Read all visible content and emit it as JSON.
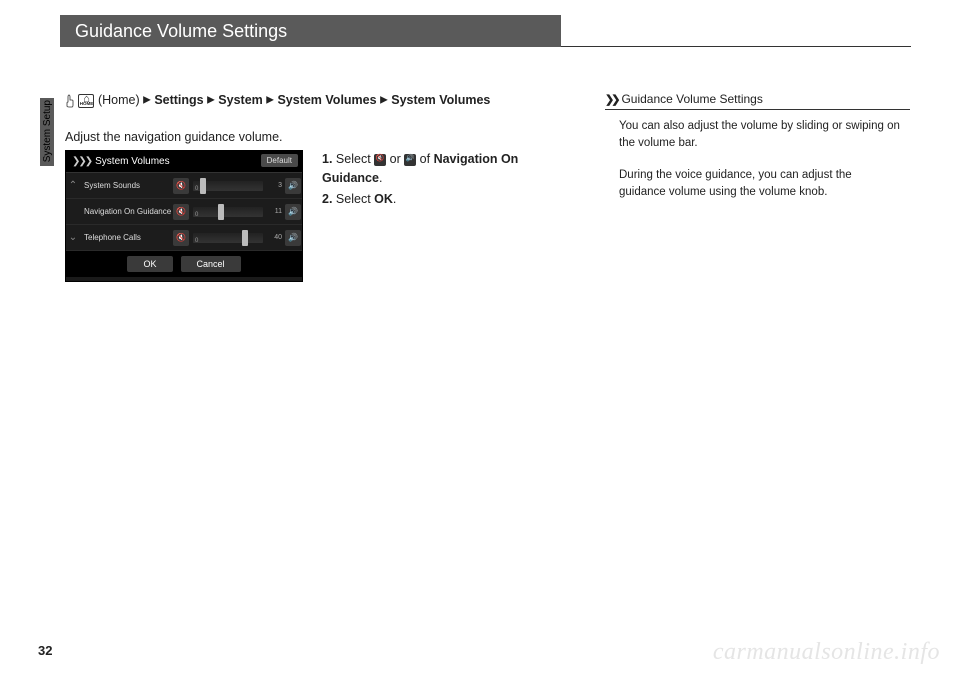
{
  "page": {
    "title": "Guidance Volume Settings",
    "number": "32",
    "side_label": "System Setup",
    "watermark": "carmanualsonline.info"
  },
  "breadcrumb": {
    "home_label": "(Home)",
    "settings": "Settings",
    "system": "System",
    "system_volumes_1": "System Volumes",
    "system_volumes_2": "System Volumes"
  },
  "intro_text": "Adjust the navigation guidance volume.",
  "screenshot": {
    "title": "System Volumes",
    "default": "Default",
    "rows": [
      {
        "label": "System Sounds",
        "value": "3",
        "handle_pct": 10
      },
      {
        "label": "Navigation On Guidance",
        "value": "11",
        "handle_pct": 35
      },
      {
        "label": "Telephone Calls",
        "value": "40",
        "handle_pct": 70
      }
    ],
    "ok": "OK",
    "cancel": "Cancel"
  },
  "steps": {
    "s1_pre": "Select ",
    "s1_mid": " or ",
    "s1_post": " of ",
    "s1_target": "Navigation On Guidance",
    "s1_end": ".",
    "s2_pre": "Select ",
    "s2_target": "OK",
    "s2_end": "."
  },
  "sidebar": {
    "heading": "Guidance Volume Settings",
    "p1": "You can also adjust the volume by sliding or swiping on the volume bar.",
    "p2": "During the voice guidance, you can adjust the guidance volume using the volume knob."
  }
}
